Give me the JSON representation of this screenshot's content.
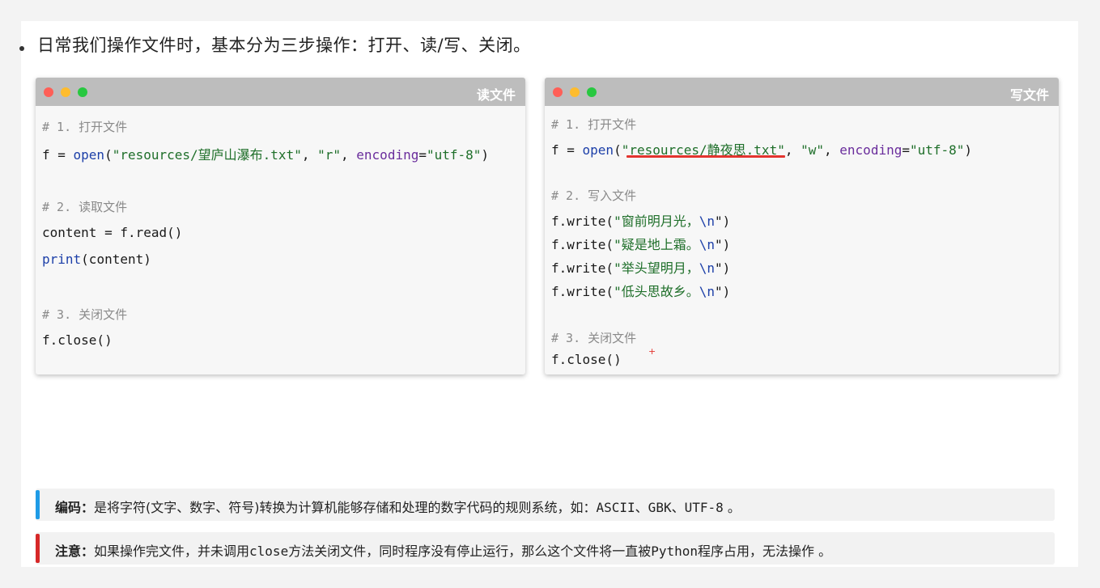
{
  "heading": "日常我们操作文件时，基本分为三步操作：打开、读/写、关闭。",
  "colors": {
    "titlebar": "#bdbdbd",
    "dot_red": "#ff5f57",
    "dot_yellow": "#febc2e",
    "dot_green": "#28c840",
    "string": "#1f6f2a",
    "keyword_arg": "#6a2d9c",
    "builtin": "#1c3fa8",
    "comment": "#8a8a8a",
    "note_info_bar": "#1e9be6",
    "note_warn_bar": "#d62828",
    "highlight_underline": "#e3342f"
  },
  "read_window": {
    "title": "读文件",
    "c1": "# 1. 打开文件",
    "l1": {
      "pre": "f = ",
      "fn": "open",
      "p1": "(",
      "s1": "\"resources/望庐山瀑布.txt\"",
      "p2": ", ",
      "s2": "\"r\"",
      "p3": ", ",
      "kw": "encoding",
      "p4": "=",
      "s3": "\"utf-8\"",
      "p5": ")"
    },
    "c2": "# 2. 读取文件",
    "l2": "content = f.read()",
    "l3": {
      "fn": "print",
      "rest": "(content)"
    },
    "c3": "# 3. 关闭文件",
    "l4": "f.close()"
  },
  "write_window": {
    "title": "写文件",
    "c1": "# 1. 打开文件",
    "l1": {
      "pre": "f = ",
      "fn": "open",
      "p1": "(",
      "s1": "\"resources/静夜思.txt\"",
      "p2": ", ",
      "s2": "\"w\"",
      "p3": ", ",
      "kw": "encoding",
      "p4": "=",
      "s3": "\"utf-8\"",
      "p5": ")"
    },
    "c2": "# 2. 写入文件",
    "writes": [
      {
        "pre": "f.write(",
        "str": "\"窗前明月光，",
        "esc": "\\n",
        "end": "\")"
      },
      {
        "pre": "f.write(",
        "str": "\"疑是地上霜。",
        "esc": "\\n",
        "end": "\")"
      },
      {
        "pre": "f.write(",
        "str": "\"举头望明月，",
        "esc": "\\n",
        "end": "\")"
      },
      {
        "pre": "f.write(",
        "str": "\"低头思故乡。",
        "esc": "\\n",
        "end": "\")"
      }
    ],
    "c3": "# 3. 关闭文件",
    "l_close": "f.close()",
    "plus_mark": "+"
  },
  "notes": [
    {
      "label": "编码：",
      "text": "是将字符(文字、数字、符号)转换为计算机能够存储和处理的数字代码的规则系统，如：",
      "mono": "ASCII、GBK、UTF-8",
      "tail": " 。"
    },
    {
      "label": "注意：",
      "text_a": "如果操作完文件，并未调用",
      "mono_a": "close",
      "text_b": "方法关闭文件，同时程序没有停止运行，那么这个文件将一直被",
      "mono_b": "Python",
      "text_c": "程序占用，无法操作 。"
    }
  ]
}
